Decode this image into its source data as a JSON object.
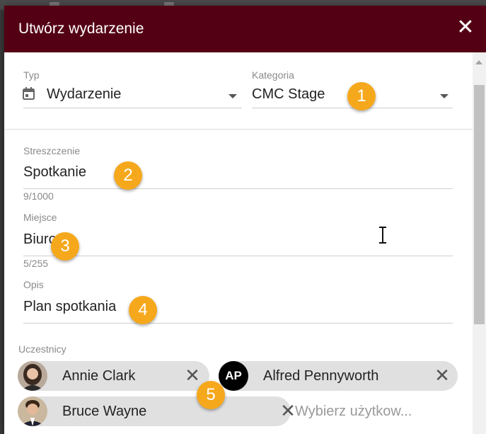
{
  "dialog": {
    "title": "Utwórz wydarzenie",
    "close_icon": "close-icon"
  },
  "type_field": {
    "label": "Typ",
    "value": "Wydarzenie",
    "icon": "calendar-icon"
  },
  "category_field": {
    "label": "Kategoria",
    "value": "CMC Stage"
  },
  "summary_field": {
    "label": "Streszczenie",
    "value": "Spotkanie",
    "counter": "9/1000"
  },
  "place_field": {
    "label": "Miejsce",
    "value": "Biuro",
    "counter": "5/255"
  },
  "description_field": {
    "label": "Opis",
    "value": "Plan spotkania"
  },
  "participants": {
    "label": "Uczestnicy",
    "chips": [
      {
        "name": "Annie Clark"
      },
      {
        "name": "Alfred Pennyworth",
        "initials": "AP"
      },
      {
        "name": "Bruce Wayne"
      }
    ],
    "placeholder": "Wybierz użytkow..."
  },
  "badges": [
    "1",
    "2",
    "3",
    "4",
    "5"
  ],
  "colors": {
    "header": "#540014",
    "badge": "#f6a81c",
    "chip": "#e0e0e0"
  }
}
